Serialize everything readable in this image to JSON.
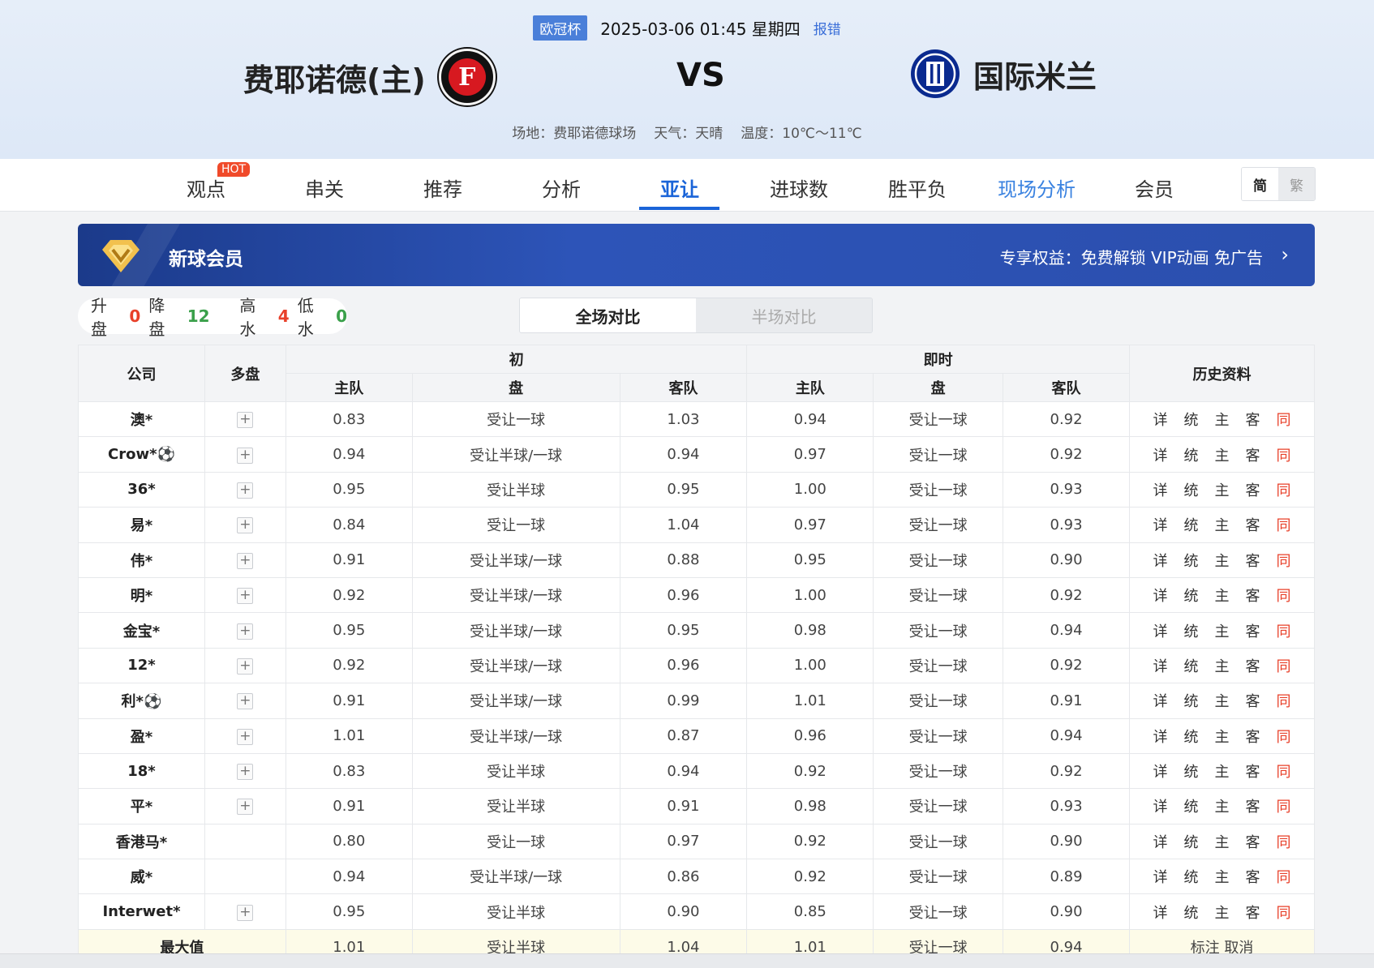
{
  "header": {
    "cup": "欧冠杯",
    "datetime": "2025-03-06 01:45 星期四",
    "report": "报错",
    "home": "费耶诺德(主)",
    "home_logo_letter": "F",
    "vs": "VS",
    "away": "国际米兰",
    "venue": "场地：费耶诺德球场",
    "weather": "天气：天晴",
    "temp": "温度：10℃～11℃"
  },
  "nav": {
    "items": [
      "观点",
      "串关",
      "推荐",
      "分析",
      "亚让",
      "进球数",
      "胜平负",
      "现场分析",
      "会员"
    ],
    "hot": "HOT",
    "lang_simp": "简",
    "lang_trad": "繁"
  },
  "vip": {
    "title": "新球会员",
    "benefit": "专享权益：免费解锁 VIP动画 免广告",
    "arrow": "›"
  },
  "summary": {
    "up_label": "升盘",
    "up": "0",
    "down_label": "降盘",
    "down": "12",
    "high_label": "高水",
    "high": "4",
    "low_label": "低水",
    "low": "0"
  },
  "compare": {
    "full": "全场对比",
    "half": "半场对比"
  },
  "table": {
    "headers": {
      "company": "公司",
      "multi": "多盘",
      "initial": "初",
      "live": "即时",
      "history": "历史资料",
      "home": "主队",
      "line": "盘",
      "away": "客队"
    },
    "rows": [
      {
        "company": "澳*",
        "plus": true,
        "ih": "0.83",
        "il": "受让一球",
        "ia": "1.03",
        "lh": "0.94",
        "ll": "受让一球",
        "la": "0.92"
      },
      {
        "company": "Crow*⚽",
        "plus": true,
        "ih": "0.94",
        "il": "受让半球/一球",
        "ia": "0.94",
        "lh": "0.97",
        "ll": "受让一球",
        "la": "0.92"
      },
      {
        "company": "36*",
        "plus": true,
        "ih": "0.95",
        "il": "受让半球",
        "ia": "0.95",
        "lh": "1.00",
        "ll": "受让一球",
        "la": "0.93"
      },
      {
        "company": "易*",
        "plus": true,
        "ih": "0.84",
        "il": "受让一球",
        "ia": "1.04",
        "lh": "0.97",
        "ll": "受让一球",
        "la": "0.93"
      },
      {
        "company": "伟*",
        "plus": true,
        "ih": "0.91",
        "il": "受让半球/一球",
        "ia": "0.88",
        "lh": "0.95",
        "ll": "受让一球",
        "la": "0.90"
      },
      {
        "company": "明*",
        "plus": true,
        "ih": "0.92",
        "il": "受让半球/一球",
        "ia": "0.96",
        "lh": "1.00",
        "ll": "受让一球",
        "la": "0.92"
      },
      {
        "company": "金宝*",
        "plus": true,
        "ih": "0.95",
        "il": "受让半球/一球",
        "ia": "0.95",
        "lh": "0.98",
        "ll": "受让一球",
        "la": "0.94"
      },
      {
        "company": "12*",
        "plus": true,
        "ih": "0.92",
        "il": "受让半球/一球",
        "ia": "0.96",
        "lh": "1.00",
        "ll": "受让一球",
        "la": "0.92"
      },
      {
        "company": "利*⚽",
        "plus": true,
        "ih": "0.91",
        "il": "受让半球/一球",
        "ia": "0.99",
        "lh": "1.01",
        "ll": "受让一球",
        "la": "0.91"
      },
      {
        "company": "盈*",
        "plus": true,
        "ih": "1.01",
        "il": "受让半球/一球",
        "ia": "0.87",
        "lh": "0.96",
        "ll": "受让一球",
        "la": "0.94"
      },
      {
        "company": "18*",
        "plus": true,
        "ih": "0.83",
        "il": "受让半球",
        "ia": "0.94",
        "lh": "0.92",
        "ll": "受让一球",
        "la": "0.92"
      },
      {
        "company": "平*",
        "plus": true,
        "ih": "0.91",
        "il": "受让半球",
        "ia": "0.91",
        "lh": "0.98",
        "ll": "受让一球",
        "la": "0.93"
      },
      {
        "company": "香港马*",
        "plus": false,
        "ih": "0.80",
        "il": "受让一球",
        "ia": "0.97",
        "lh": "0.92",
        "ll": "受让一球",
        "la": "0.90"
      },
      {
        "company": "威*",
        "plus": false,
        "ih": "0.94",
        "il": "受让半球/一球",
        "ia": "0.86",
        "lh": "0.92",
        "ll": "受让一球",
        "la": "0.89"
      },
      {
        "company": "Interwet*",
        "plus": true,
        "ih": "0.95",
        "il": "受让半球",
        "ia": "0.90",
        "lh": "0.85",
        "ll": "受让一球",
        "la": "0.90"
      }
    ],
    "history_links": [
      "详",
      "统",
      "主",
      "客",
      "同"
    ],
    "max_row": {
      "label": "最大值",
      "ih": "1.01",
      "il": "受让半球",
      "ia": "1.04",
      "lh": "1.01",
      "ll": "受让一球",
      "la": "0.94",
      "mark": "标注 取消"
    }
  },
  "colors": {
    "accent": "#1a64d8",
    "red": "#e8402a",
    "green": "#3aa04a"
  }
}
